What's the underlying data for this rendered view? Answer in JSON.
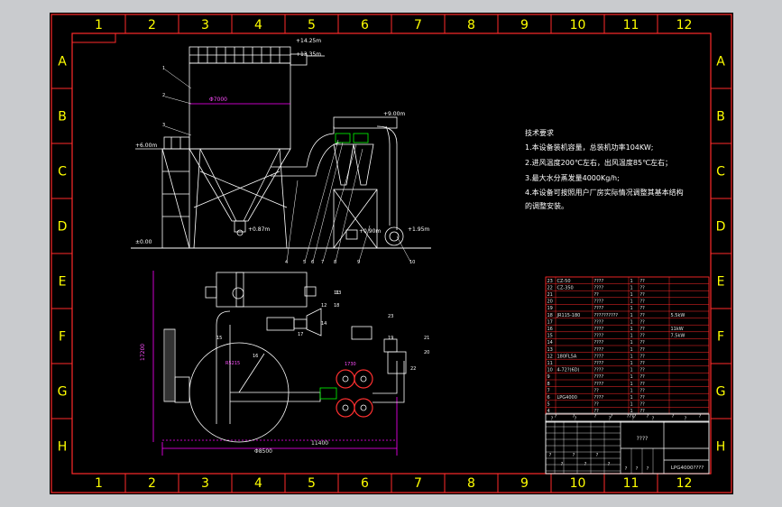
{
  "grid": {
    "columns": [
      "1",
      "2",
      "3",
      "4",
      "5",
      "6",
      "7",
      "8",
      "9",
      "10",
      "11",
      "12"
    ],
    "rows": [
      "A",
      "B",
      "C",
      "D",
      "E",
      "F",
      "G",
      "H"
    ]
  },
  "colors": {
    "background": "#000000",
    "frame": "#ff2a2a",
    "grid_text": "#ffff00",
    "lines": "#ffffff",
    "dimension": "#ff00ff",
    "annotation": "#00ff00",
    "pipe": "#ff3030",
    "outer": "#c9cbce"
  },
  "elevations": {
    "e1": "+14.25m",
    "e2": "+13.35m",
    "e3": "+9.00m",
    "e4": "+6.00m",
    "e5": "±0.00",
    "e6": "+0.87m",
    "e7": "+0.90m",
    "e8": "+1.95m"
  },
  "dimensions": {
    "diameter": "Φ7000",
    "plan_h": "Φ8500",
    "plan_v": "17200",
    "plan_w1": "11400",
    "plan_w2": "1730",
    "plan_r": "R5215"
  },
  "notes": {
    "title": "技术要求",
    "lines": [
      "1.本设备装机容量，总装机功率104KW;",
      "2.进风温度200℃左右，出风温度85℃左右；",
      "3.最大水分蒸发量4000Kg/h;",
      "4.本设备可按照用户厂房实际情况调整其基本结构",
      "的调整安装。"
    ]
  },
  "leaders": [
    "1",
    "2",
    "3",
    "4",
    "5",
    "6",
    "7",
    "8",
    "9",
    "10",
    "11",
    "12",
    "13",
    "14",
    "15",
    "16",
    "17",
    "18",
    "19",
    "20",
    "21",
    "22",
    "23"
  ],
  "parts_list": {
    "rows": [
      {
        "no": "23",
        "code": "CZ-50",
        "name": "????",
        "qty": "1",
        "mat": "??"
      },
      {
        "no": "22",
        "code": "CZ-350",
        "name": "????",
        "qty": "1",
        "mat": "??"
      },
      {
        "no": "21",
        "code": "",
        "name": "??",
        "qty": "1",
        "mat": "??"
      },
      {
        "no": "20",
        "code": "",
        "name": "????",
        "qty": "1",
        "mat": "??"
      },
      {
        "no": "19",
        "code": "",
        "name": "????",
        "qty": "1",
        "mat": "??"
      },
      {
        "no": "18",
        "code": "JR115-180",
        "name": "??????????",
        "qty": "1",
        "mat": "??",
        "remark": "5.5kW"
      },
      {
        "no": "17",
        "code": "",
        "name": "????",
        "qty": "1",
        "mat": "??"
      },
      {
        "no": "16",
        "code": "",
        "name": "????",
        "qty": "1",
        "mat": "??",
        "remark": "11kW"
      },
      {
        "no": "15",
        "code": "",
        "name": "????",
        "qty": "1",
        "mat": "??",
        "remark": "7.5kW"
      },
      {
        "no": "14",
        "code": "",
        "name": "????",
        "qty": "1",
        "mat": "??"
      },
      {
        "no": "13",
        "code": "",
        "name": "????",
        "qty": "1",
        "mat": "??"
      },
      {
        "no": "12",
        "code": "180FL5A",
        "name": "????",
        "qty": "1",
        "mat": "??"
      },
      {
        "no": "11",
        "code": "",
        "name": "????",
        "qty": "1",
        "mat": "??"
      },
      {
        "no": "10",
        "code": "4-72?(6D)",
        "name": "????",
        "qty": "1",
        "mat": "??"
      },
      {
        "no": "9",
        "code": "",
        "name": "????",
        "qty": "1",
        "mat": "??"
      },
      {
        "no": "8",
        "code": "",
        "name": "????",
        "qty": "1",
        "mat": "??"
      },
      {
        "no": "7",
        "code": "",
        "name": "??",
        "qty": "1",
        "mat": "??"
      },
      {
        "no": "6",
        "code": "LPG4000",
        "name": "????",
        "qty": "1",
        "mat": "??"
      },
      {
        "no": "5",
        "code": "",
        "name": "??",
        "qty": "1",
        "mat": "??"
      },
      {
        "no": "4",
        "code": "",
        "name": "??",
        "qty": "1",
        "mat": "??"
      }
    ],
    "header": [
      "序号",
      "代号",
      "名称",
      "数量",
      "材料",
      "备注"
    ],
    "header_marks": [
      "?",
      "?",
      "?",
      "?",
      "?",
      "?"
    ]
  },
  "title_block": {
    "name": "????",
    "drawing_no": "LPG4000????",
    "marks": [
      "?",
      "?",
      "?",
      "?",
      "?",
      "?"
    ],
    "scale_marks": [
      "?",
      "?",
      "?"
    ],
    "sheet_marks": [
      "?",
      "?",
      "?",
      "?",
      "?",
      "?"
    ],
    "small_marks": [
      "?",
      "?",
      "?",
      "?",
      "????",
      "?",
      "?",
      "?"
    ]
  }
}
